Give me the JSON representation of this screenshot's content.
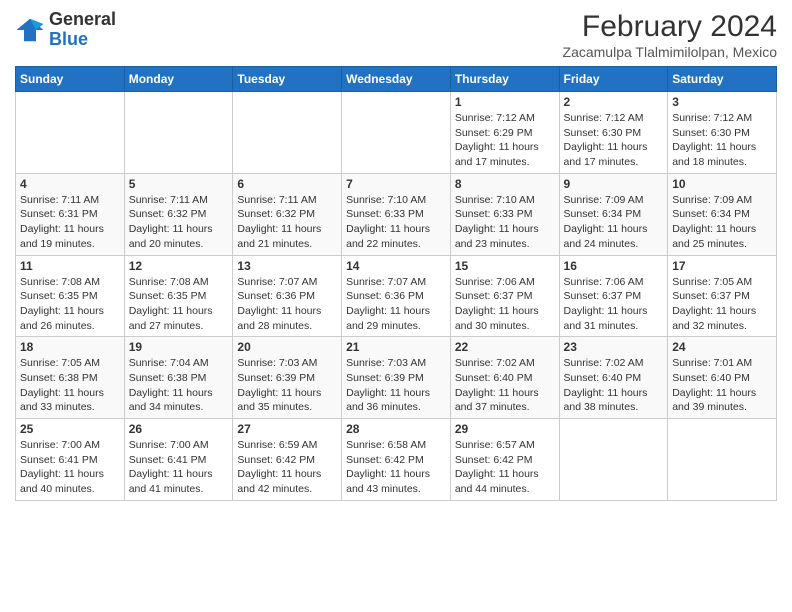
{
  "logo": {
    "line1": "General",
    "line2": "Blue"
  },
  "title": "February 2024",
  "subtitle": "Zacamulpa Tlalmimilolpan, Mexico",
  "days_of_week": [
    "Sunday",
    "Monday",
    "Tuesday",
    "Wednesday",
    "Thursday",
    "Friday",
    "Saturday"
  ],
  "weeks": [
    [
      {
        "day": "",
        "info": ""
      },
      {
        "day": "",
        "info": ""
      },
      {
        "day": "",
        "info": ""
      },
      {
        "day": "",
        "info": ""
      },
      {
        "day": "1",
        "info": "Sunrise: 7:12 AM\nSunset: 6:29 PM\nDaylight: 11 hours and 17 minutes."
      },
      {
        "day": "2",
        "info": "Sunrise: 7:12 AM\nSunset: 6:30 PM\nDaylight: 11 hours and 17 minutes."
      },
      {
        "day": "3",
        "info": "Sunrise: 7:12 AM\nSunset: 6:30 PM\nDaylight: 11 hours and 18 minutes."
      }
    ],
    [
      {
        "day": "4",
        "info": "Sunrise: 7:11 AM\nSunset: 6:31 PM\nDaylight: 11 hours and 19 minutes."
      },
      {
        "day": "5",
        "info": "Sunrise: 7:11 AM\nSunset: 6:32 PM\nDaylight: 11 hours and 20 minutes."
      },
      {
        "day": "6",
        "info": "Sunrise: 7:11 AM\nSunset: 6:32 PM\nDaylight: 11 hours and 21 minutes."
      },
      {
        "day": "7",
        "info": "Sunrise: 7:10 AM\nSunset: 6:33 PM\nDaylight: 11 hours and 22 minutes."
      },
      {
        "day": "8",
        "info": "Sunrise: 7:10 AM\nSunset: 6:33 PM\nDaylight: 11 hours and 23 minutes."
      },
      {
        "day": "9",
        "info": "Sunrise: 7:09 AM\nSunset: 6:34 PM\nDaylight: 11 hours and 24 minutes."
      },
      {
        "day": "10",
        "info": "Sunrise: 7:09 AM\nSunset: 6:34 PM\nDaylight: 11 hours and 25 minutes."
      }
    ],
    [
      {
        "day": "11",
        "info": "Sunrise: 7:08 AM\nSunset: 6:35 PM\nDaylight: 11 hours and 26 minutes."
      },
      {
        "day": "12",
        "info": "Sunrise: 7:08 AM\nSunset: 6:35 PM\nDaylight: 11 hours and 27 minutes."
      },
      {
        "day": "13",
        "info": "Sunrise: 7:07 AM\nSunset: 6:36 PM\nDaylight: 11 hours and 28 minutes."
      },
      {
        "day": "14",
        "info": "Sunrise: 7:07 AM\nSunset: 6:36 PM\nDaylight: 11 hours and 29 minutes."
      },
      {
        "day": "15",
        "info": "Sunrise: 7:06 AM\nSunset: 6:37 PM\nDaylight: 11 hours and 30 minutes."
      },
      {
        "day": "16",
        "info": "Sunrise: 7:06 AM\nSunset: 6:37 PM\nDaylight: 11 hours and 31 minutes."
      },
      {
        "day": "17",
        "info": "Sunrise: 7:05 AM\nSunset: 6:37 PM\nDaylight: 11 hours and 32 minutes."
      }
    ],
    [
      {
        "day": "18",
        "info": "Sunrise: 7:05 AM\nSunset: 6:38 PM\nDaylight: 11 hours and 33 minutes."
      },
      {
        "day": "19",
        "info": "Sunrise: 7:04 AM\nSunset: 6:38 PM\nDaylight: 11 hours and 34 minutes."
      },
      {
        "day": "20",
        "info": "Sunrise: 7:03 AM\nSunset: 6:39 PM\nDaylight: 11 hours and 35 minutes."
      },
      {
        "day": "21",
        "info": "Sunrise: 7:03 AM\nSunset: 6:39 PM\nDaylight: 11 hours and 36 minutes."
      },
      {
        "day": "22",
        "info": "Sunrise: 7:02 AM\nSunset: 6:40 PM\nDaylight: 11 hours and 37 minutes."
      },
      {
        "day": "23",
        "info": "Sunrise: 7:02 AM\nSunset: 6:40 PM\nDaylight: 11 hours and 38 minutes."
      },
      {
        "day": "24",
        "info": "Sunrise: 7:01 AM\nSunset: 6:40 PM\nDaylight: 11 hours and 39 minutes."
      }
    ],
    [
      {
        "day": "25",
        "info": "Sunrise: 7:00 AM\nSunset: 6:41 PM\nDaylight: 11 hours and 40 minutes."
      },
      {
        "day": "26",
        "info": "Sunrise: 7:00 AM\nSunset: 6:41 PM\nDaylight: 11 hours and 41 minutes."
      },
      {
        "day": "27",
        "info": "Sunrise: 6:59 AM\nSunset: 6:42 PM\nDaylight: 11 hours and 42 minutes."
      },
      {
        "day": "28",
        "info": "Sunrise: 6:58 AM\nSunset: 6:42 PM\nDaylight: 11 hours and 43 minutes."
      },
      {
        "day": "29",
        "info": "Sunrise: 6:57 AM\nSunset: 6:42 PM\nDaylight: 11 hours and 44 minutes."
      },
      {
        "day": "",
        "info": ""
      },
      {
        "day": "",
        "info": ""
      }
    ]
  ]
}
